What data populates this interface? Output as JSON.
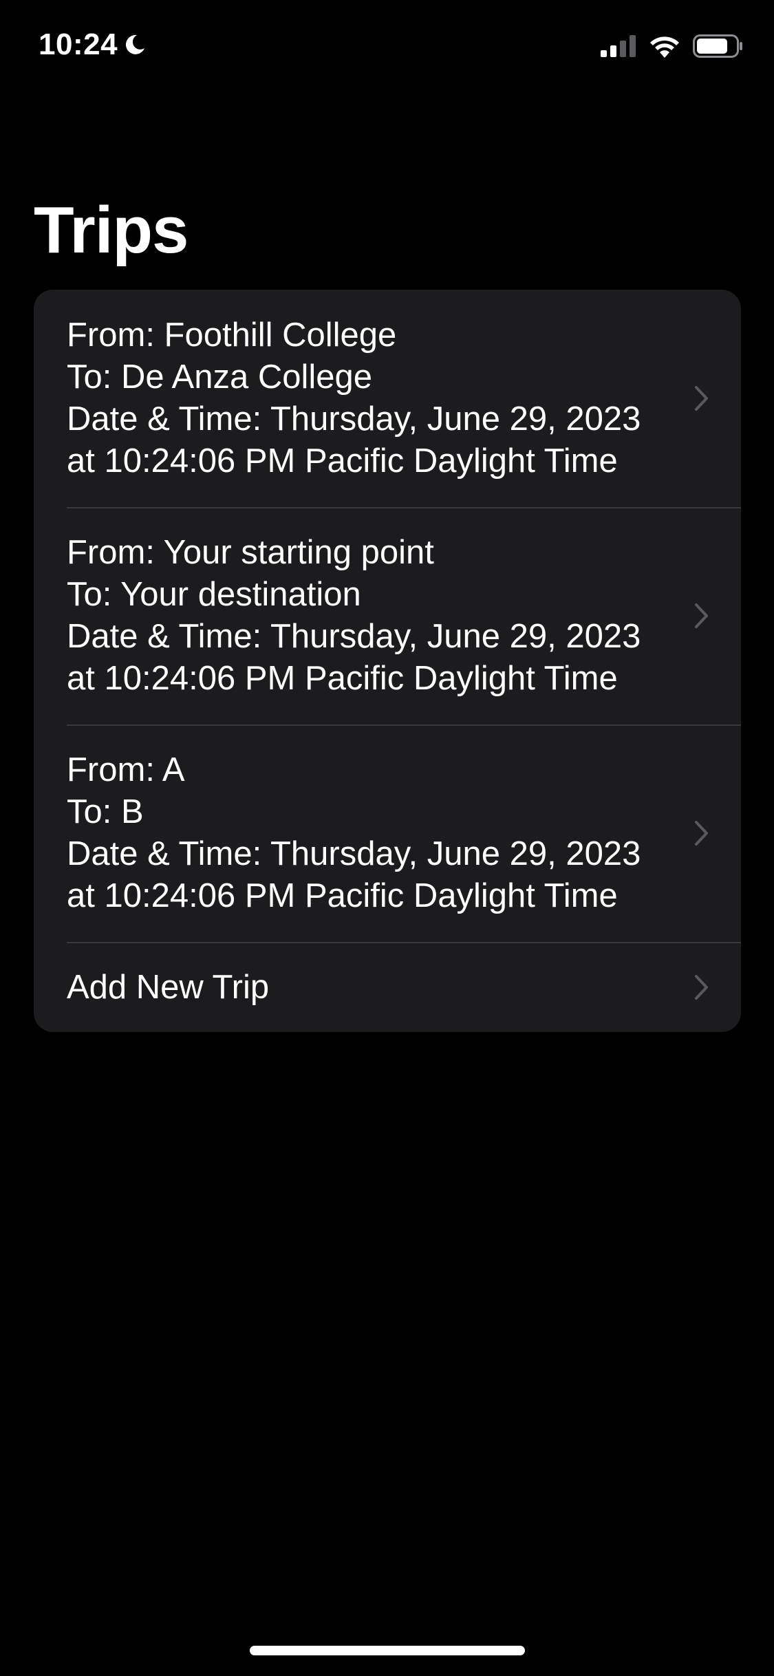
{
  "status_bar": {
    "time": "10:24",
    "moon_icon": "moon-icon",
    "signal_icon": "cellular-signal-icon",
    "wifi_icon": "wifi-icon",
    "battery_icon": "battery-icon"
  },
  "title": "Trips",
  "trips": [
    {
      "from": "From: Foothill College",
      "to": "To: De Anza College",
      "date": "Date & Time: Thursday, June 29, 2023 at 10:24:06 PM Pacific Daylight Time"
    },
    {
      "from": "From: Your starting point",
      "to": "To: Your destination",
      "date": "Date & Time: Thursday, June 29, 2023 at 10:24:06 PM Pacific Daylight Time"
    },
    {
      "from": "From: A",
      "to": "To: B",
      "date": "Date & Time: Thursday, June 29, 2023 at 10:24:06 PM Pacific Daylight Time"
    }
  ],
  "add_trip_label": "Add New Trip",
  "colors": {
    "background": "#000000",
    "card": "#1c1c1e",
    "separator": "#38383a",
    "chevron": "#5a5a5e",
    "text": "#ffffff"
  }
}
